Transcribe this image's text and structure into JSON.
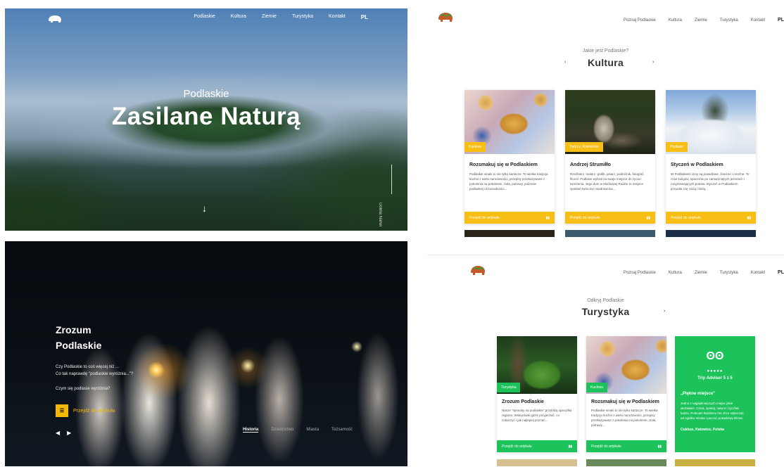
{
  "hero": {
    "nav": [
      "Podlaskie",
      "Kultura",
      "Ziemie",
      "Turystyka",
      "Kontakt"
    ],
    "lang": "PL",
    "subtitle": "Podlaskie",
    "title": "Zasilane Naturą",
    "scroll_arrow": "↓",
    "side_text": "Dolina Narwi"
  },
  "article": {
    "title_line1": "Zrozum",
    "title_line2": "Podlaskie",
    "question1": "Czy Podlaskie to coś więcej niż ...",
    "question2": "Co tak naprawdę \"podlaskie wyróżnia...\"?",
    "question3": "Czym się podlasie wyróżnia?",
    "icon_label": "☰",
    "link": "Przejdź do artykułu",
    "tabs": [
      "Historia",
      "Dziedzictwo",
      "Miasta",
      "Tożsamość"
    ]
  },
  "kultura": {
    "nav": [
      "Poznaj Podlaskie",
      "Kultura",
      "Ziemie",
      "Turystyka",
      "Kontakt"
    ],
    "lang": "PL",
    "subtitle": "Jakie jest Podlaskie?",
    "title": "Kultura",
    "arrow_left": "‹",
    "arrow_right": "›",
    "cards": [
      {
        "badge": "Kuchnia",
        "title": "Rozsmakuj się w Podlaskiem",
        "body": "Podlaskie smaki to nie tylko kartacze. To wielka tradycja kuchni z wielu narodowości, przepisy przekazywane z pokolenia na pokolenie, zioła, potrawy, jedzenie podlaskiej różnorodności...",
        "link": "Przejdź do artykułu",
        "icon": "▮▮"
      },
      {
        "badge": "Twórcy, Rzemiosło",
        "title": "Andrzej Strumiłło",
        "body": "Rzeźbiarz, malarz, grafik, pisarz, podróżnik, fotograf, filozof. Podlasie wybrał na swoje miejsce do życia i tworzenia. Jego dom w Maćkowej Rudzie to miejsce spotkań twórców i wędrowców...",
        "link": "Przejdź do artykułu",
        "icon": "▮▮"
      },
      {
        "badge": "Podlasie",
        "title": "Styczeń w Podlaskiem",
        "body": "W Podlaskiem zimy są prawdziwe, śnieżne i mroźne. To czas kuligów, spacerów po zamarzniętych jeziorach i rozgrzewających potraw. Styczeń w Podlaskiem przywita Cię ciszą i bielą...",
        "link": "Przejdź do artykułu",
        "icon": "▮▮"
      }
    ]
  },
  "turystyka": {
    "nav": [
      "Poznaj Podlaskie",
      "Kultura",
      "Ziemie",
      "Turystyka",
      "Kontakt"
    ],
    "lang": "PL",
    "subtitle": "Odkryj Podlaskie",
    "title": "Turystyka",
    "arrow_left": "‹",
    "arrow_right": "›",
    "cards": [
      {
        "badge": "Turystyka",
        "title": "Zrozum Podlaskie",
        "body": "Nasze \"sposoby na podlaskie\" przybliżą specyfikę regionu. Wskazówki gdzie przyjechać, co zobaczyć i jak najlepiej poznać...",
        "link": "Przejdź do artykułu",
        "icon": "▮▮"
      },
      {
        "badge": "Kuchnia",
        "title": "Rozsmakuj się w Podlaskiem",
        "body": "Podlaskie smaki to nie tylko kartacze. To wielka tradycja kuchni z wielu narodowości, przepisy przekazywane z pokolenia na pokolenie, zioła, potrawy...",
        "link": "Przejdź do artykułu",
        "icon": "▮▮"
      }
    ],
    "tripadvisor": {
      "logo": "ʘʘ",
      "stars": "●●●●●",
      "rating": "Trip Advisor 5 z 5",
      "quote": "„Piękne miejsce”",
      "review": "Jedno z najpiękniejszych miejsc jakie widziałam. Cisza, spokój, natura i życzliwi ludzie. Polecam każdemu kto chce odpocząć od zgiełku miasta i poczuć prawdziwy klimat.",
      "author": "Cukbus, Katowice, Polska"
    }
  },
  "colors": {
    "yellow": "#f7be16",
    "green": "#1cc35a"
  }
}
